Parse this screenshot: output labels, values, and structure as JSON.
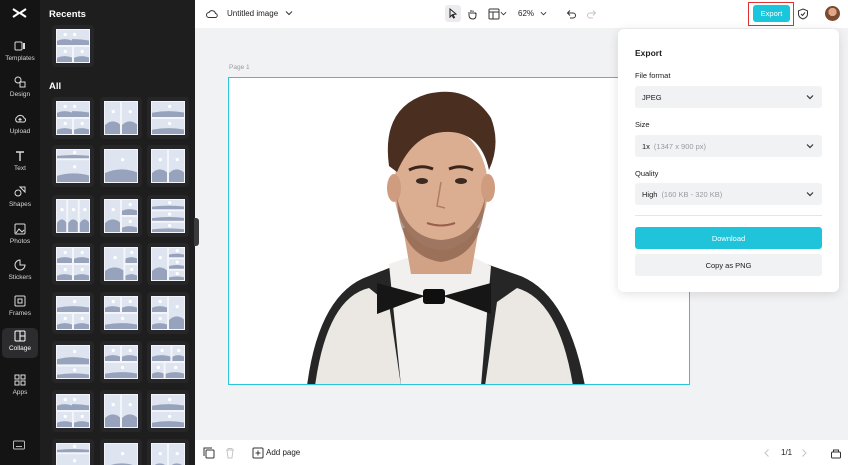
{
  "rail": {
    "items": [
      {
        "label": "Templates",
        "icon": "templates-icon"
      },
      {
        "label": "Design",
        "icon": "design-icon"
      },
      {
        "label": "Upload",
        "icon": "upload-icon"
      },
      {
        "label": "Text",
        "icon": "text-icon"
      },
      {
        "label": "Shapes",
        "icon": "shapes-icon"
      },
      {
        "label": "Photos",
        "icon": "photos-icon"
      },
      {
        "label": "Stickers",
        "icon": "stickers-icon"
      },
      {
        "label": "Frames",
        "icon": "frames-icon"
      },
      {
        "label": "Collage",
        "icon": "collage-icon",
        "active": true
      },
      {
        "label": "Apps",
        "icon": "apps-icon"
      }
    ]
  },
  "panel": {
    "recents_heading": "Recents",
    "all_heading": "All"
  },
  "topbar": {
    "doc_title": "Untitled image",
    "zoom": "62%",
    "export_label": "Export"
  },
  "canvas": {
    "page_label": "Page 1"
  },
  "bottombar": {
    "add_page": "Add page",
    "pages": "1/1"
  },
  "export_popup": {
    "title": "Export",
    "file_format_label": "File format",
    "file_format_value": "JPEG",
    "size_label": "Size",
    "size_value": "1x",
    "size_detail": "(1347 x 900 px)",
    "quality_label": "Quality",
    "quality_value": "High",
    "quality_detail": "(160 KB - 320 KB)",
    "download_label": "Download",
    "copy_label": "Copy as PNG"
  },
  "colors": {
    "accent": "#19c6dc",
    "highlight": "#e03131"
  }
}
